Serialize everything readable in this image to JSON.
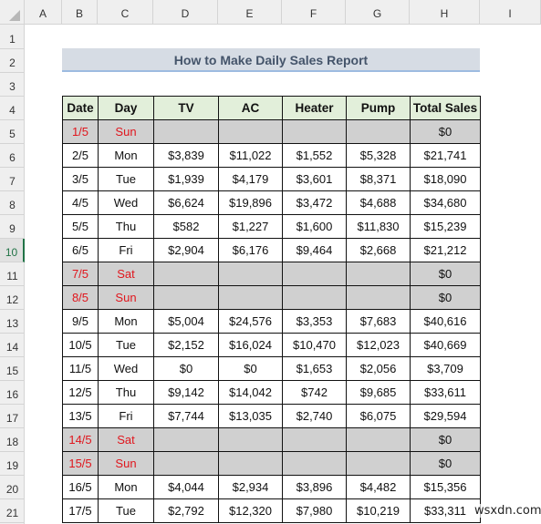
{
  "spreadsheet": {
    "column_headers": [
      "A",
      "B",
      "C",
      "D",
      "E",
      "F",
      "G",
      "H",
      "I"
    ],
    "row_headers": [
      "1",
      "2",
      "3",
      "4",
      "5",
      "6",
      "7",
      "8",
      "9",
      "10",
      "11",
      "12",
      "13",
      "14",
      "15",
      "16",
      "17",
      "18",
      "19",
      "20",
      "21"
    ],
    "active_row": "10"
  },
  "title": "How to Make Daily Sales Report",
  "table": {
    "headers": [
      "Date",
      "Day",
      "TV",
      "AC",
      "Heater",
      "Pump",
      "Total Sales"
    ],
    "rows": [
      {
        "date": "1/5",
        "day": "Sun",
        "tv": "",
        "ac": "",
        "heater": "",
        "pump": "",
        "total": "$0",
        "weekend": true
      },
      {
        "date": "2/5",
        "day": "Mon",
        "tv": "$3,839",
        "ac": "$11,022",
        "heater": "$1,552",
        "pump": "$5,328",
        "total": "$21,741",
        "weekend": false
      },
      {
        "date": "3/5",
        "day": "Tue",
        "tv": "$1,939",
        "ac": "$4,179",
        "heater": "$3,601",
        "pump": "$8,371",
        "total": "$18,090",
        "weekend": false
      },
      {
        "date": "4/5",
        "day": "Wed",
        "tv": "$6,624",
        "ac": "$19,896",
        "heater": "$3,472",
        "pump": "$4,688",
        "total": "$34,680",
        "weekend": false
      },
      {
        "date": "5/5",
        "day": "Thu",
        "tv": "$582",
        "ac": "$1,227",
        "heater": "$1,600",
        "pump": "$11,830",
        "total": "$15,239",
        "weekend": false
      },
      {
        "date": "6/5",
        "day": "Fri",
        "tv": "$2,904",
        "ac": "$6,176",
        "heater": "$9,464",
        "pump": "$2,668",
        "total": "$21,212",
        "weekend": false
      },
      {
        "date": "7/5",
        "day": "Sat",
        "tv": "",
        "ac": "",
        "heater": "",
        "pump": "",
        "total": "$0",
        "weekend": true
      },
      {
        "date": "8/5",
        "day": "Sun",
        "tv": "",
        "ac": "",
        "heater": "",
        "pump": "",
        "total": "$0",
        "weekend": true
      },
      {
        "date": "9/5",
        "day": "Mon",
        "tv": "$5,004",
        "ac": "$24,576",
        "heater": "$3,353",
        "pump": "$7,683",
        "total": "$40,616",
        "weekend": false
      },
      {
        "date": "10/5",
        "day": "Tue",
        "tv": "$2,152",
        "ac": "$16,024",
        "heater": "$10,470",
        "pump": "$12,023",
        "total": "$40,669",
        "weekend": false
      },
      {
        "date": "11/5",
        "day": "Wed",
        "tv": "$0",
        "ac": "$0",
        "heater": "$1,653",
        "pump": "$2,056",
        "total": "$3,709",
        "weekend": false
      },
      {
        "date": "12/5",
        "day": "Thu",
        "tv": "$9,142",
        "ac": "$14,042",
        "heater": "$742",
        "pump": "$9,685",
        "total": "$33,611",
        "weekend": false
      },
      {
        "date": "13/5",
        "day": "Fri",
        "tv": "$7,744",
        "ac": "$13,035",
        "heater": "$2,740",
        "pump": "$6,075",
        "total": "$29,594",
        "weekend": false
      },
      {
        "date": "14/5",
        "day": "Sat",
        "tv": "",
        "ac": "",
        "heater": "",
        "pump": "",
        "total": "$0",
        "weekend": true
      },
      {
        "date": "15/5",
        "day": "Sun",
        "tv": "",
        "ac": "",
        "heater": "",
        "pump": "",
        "total": "$0",
        "weekend": true
      },
      {
        "date": "16/5",
        "day": "Mon",
        "tv": "$4,044",
        "ac": "$2,934",
        "heater": "$3,896",
        "pump": "$4,482",
        "total": "$15,356",
        "weekend": false
      },
      {
        "date": "17/5",
        "day": "Tue",
        "tv": "$2,792",
        "ac": "$12,320",
        "heater": "$7,980",
        "pump": "$10,219",
        "total": "$33,311",
        "weekend": false
      }
    ]
  },
  "colors": {
    "header_fill": "#e2efda",
    "weekend_fill": "#d0d0d0",
    "weekend_text": "#e0161d",
    "title_fill": "#d6dce4",
    "title_text": "#44546a",
    "active_row_accent": "#217346"
  },
  "watermark": "wsxdn.com"
}
